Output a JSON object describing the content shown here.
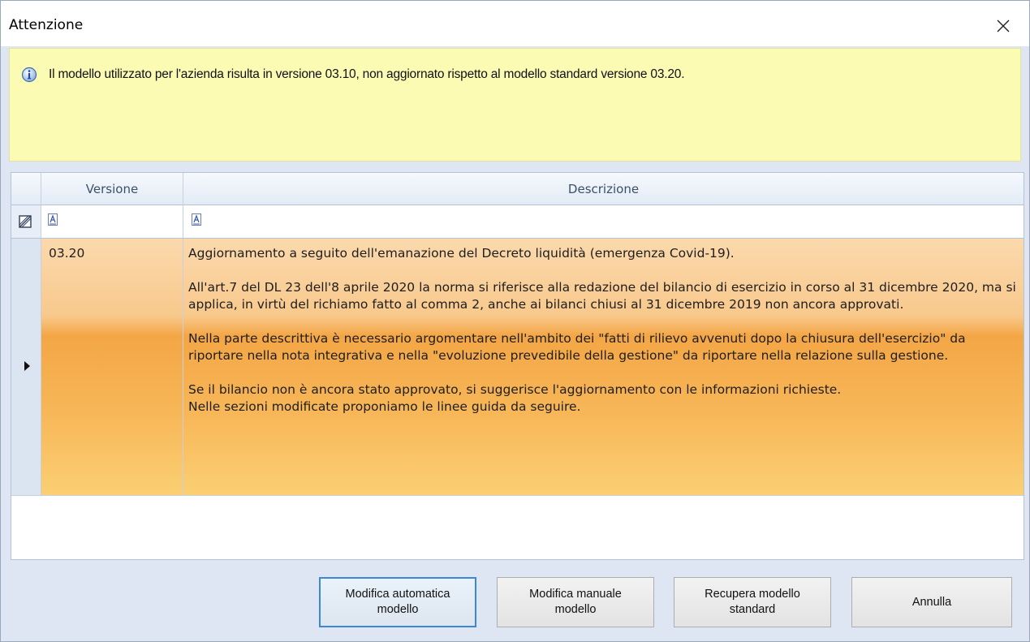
{
  "dialog": {
    "title": "Attenzione"
  },
  "info": {
    "icon": "info-icon",
    "message": "Il modello utilizzato per l'azienda risulta in versione 03.10, non aggiornato rispetto al modello standard versione 03.20."
  },
  "grid": {
    "columns": [
      "Versione",
      "Descrizione"
    ],
    "rows": [
      {
        "version": "03.20",
        "description": {
          "p1": "Aggiornamento a seguito dell'emanazione del Decreto liquidità (emergenza Covid-19).",
          "p2": "All'art.7 del DL 23 dell'8 aprile 2020 la norma si riferisce alla redazione del bilancio di esercizio in corso al 31 dicembre 2020, ma si applica, in virtù del richiamo fatto al comma 2, anche ai bilanci chiusi al 31 dicembre 2019 non ancora approvati.",
          "p3": "Nella parte descrittiva è necessario argomentare nell'ambito dei \"fatti di rilievo avvenuti dopo la chiusura dell'esercizio\" da riportare nella nota integrativa e nella \"evoluzione prevedibile della gestione\" da riportare nella relazione sulla gestione.",
          "p4": "Se il bilancio non è ancora stato approvato, si suggerisce l'aggiornamento con le informazioni richieste.",
          "p5": "Nelle sezioni modificate proponiamo le linee guida da seguire."
        }
      }
    ]
  },
  "buttons": {
    "auto": "Modifica automatica modello",
    "manual": "Modifica manuale modello",
    "restore": "Recupera modello standard",
    "cancel": "Annulla"
  },
  "colors": {
    "info_bg": "#fbfbb4",
    "row_highlight": "#f4a645",
    "focus_border": "#3c88d4"
  }
}
